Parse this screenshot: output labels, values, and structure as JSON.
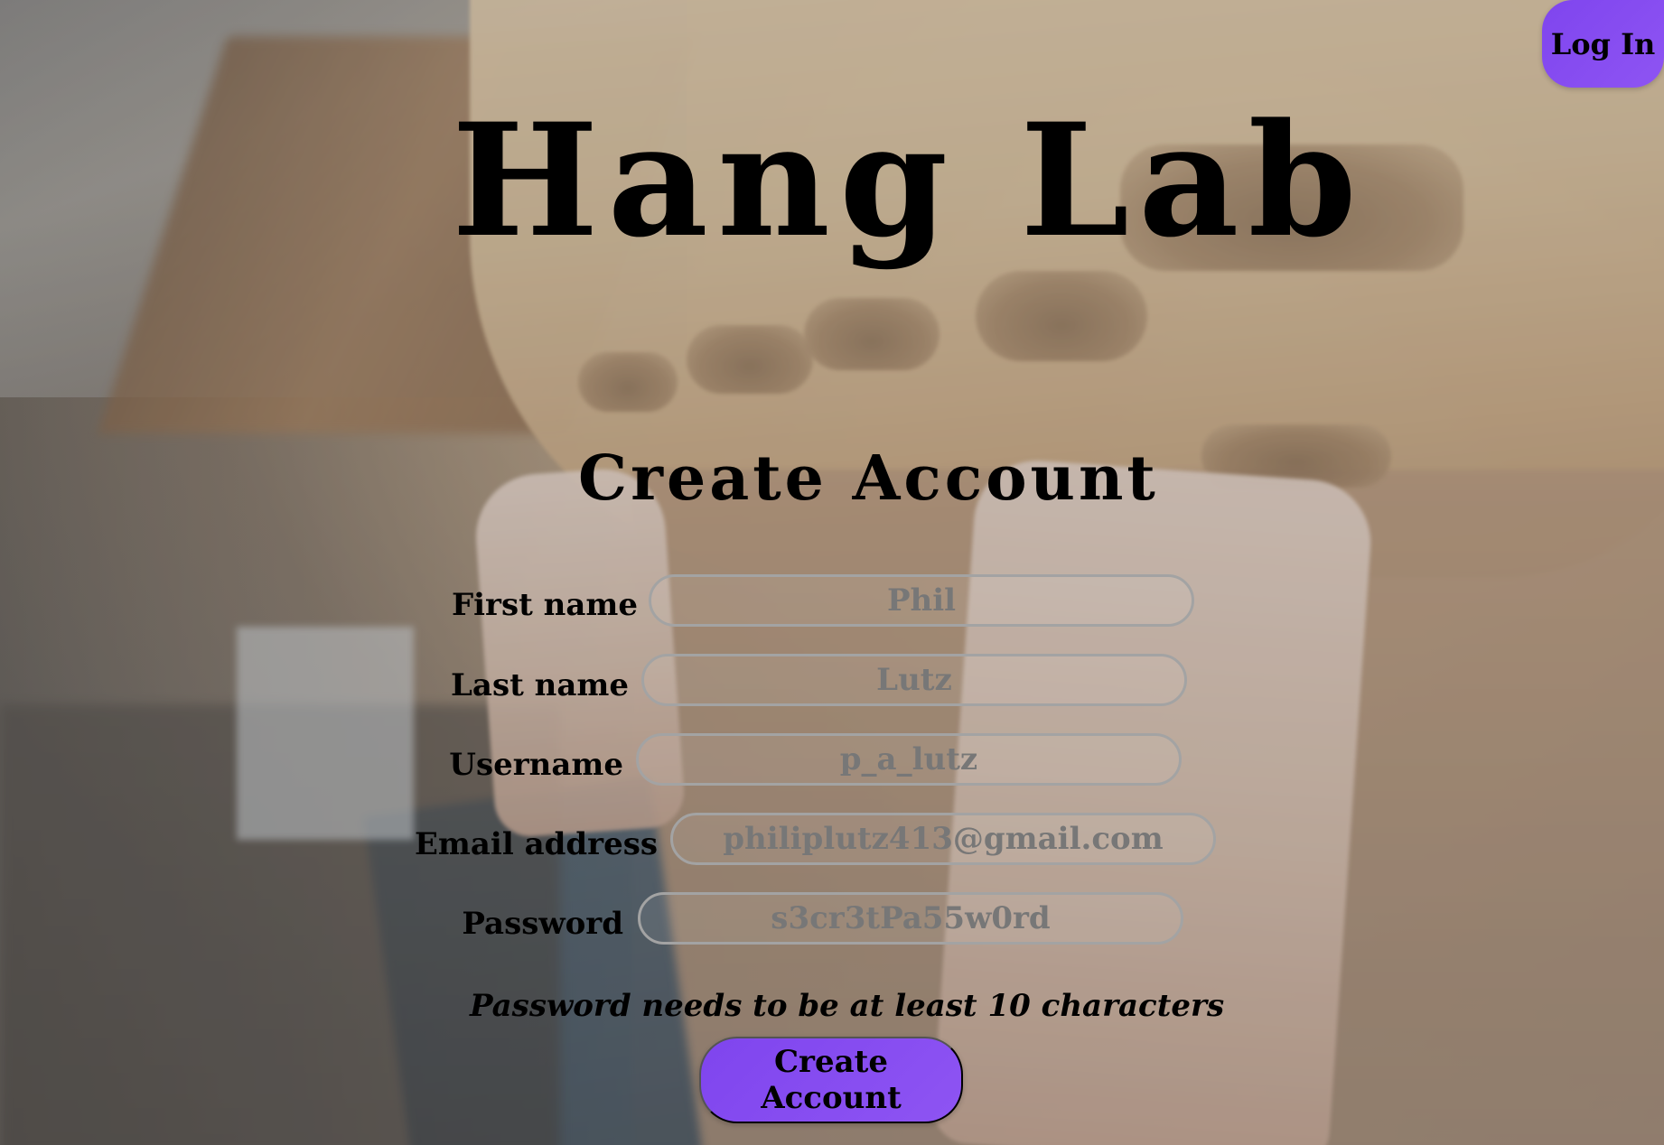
{
  "app": {
    "title": "Hang Lab"
  },
  "header": {
    "login_label": "Log In"
  },
  "page": {
    "title": "Create Account"
  },
  "form": {
    "fields": [
      {
        "label": "First name",
        "value": "Phil"
      },
      {
        "label": "Last name",
        "value": "Lutz"
      },
      {
        "label": "Username",
        "value": "p_a_lutz"
      },
      {
        "label": "Email address",
        "value": "philiplutz413@gmail.com"
      },
      {
        "label": "Password",
        "value": "s3cr3tPa55w0rd"
      }
    ],
    "password_hint": "Password needs to be at least 10 characters",
    "submit_label": "Create Account"
  },
  "colors": {
    "accent": "#8a50f0",
    "input_border": "#a3a3a3",
    "input_text": "#777777",
    "text": "#000000"
  }
}
